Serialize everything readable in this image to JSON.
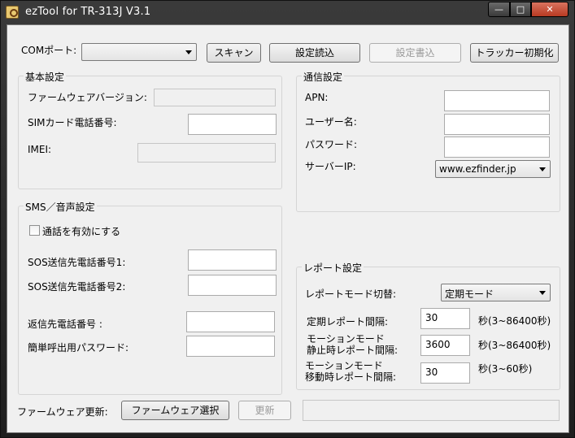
{
  "window": {
    "title": "ezTool for TR-313J V3.1",
    "buttons": {
      "minimize": "—",
      "maximize": "□",
      "close": "✕"
    }
  },
  "top": {
    "com_label": "COMポート:",
    "com_value": "",
    "scan": "スキャン",
    "read": "設定読込",
    "write": "設定書込",
    "reset": "トラッカー初期化"
  },
  "basic": {
    "title": "基本設定",
    "firmware_label": "ファームウェアバージョン:",
    "firmware_value": "",
    "sim_label": "SIMカード電話番号:",
    "sim_value": "",
    "imei_label": "IMEI:",
    "imei_value": ""
  },
  "comm": {
    "title": "通信設定",
    "apn_label": "APN:",
    "apn_value": "",
    "user_label": "ユーザー名:",
    "user_value": "",
    "pass_label": "パスワード:",
    "pass_value": "",
    "server_label": "サーバーIP:",
    "server_value": "www.ezfinder.jp"
  },
  "sms": {
    "title": "SMS／音声設定",
    "enable_call": "通話を有効にする",
    "enable_call_checked": false,
    "sos1_label": "SOS送信先電話番号1:",
    "sos1_value": "",
    "sos2_label": "SOS送信先電話番号2:",
    "sos2_value": "",
    "reply_label": "返信先電話番号 :",
    "reply_value": "",
    "simple_pass_label": "簡単呼出用パスワード:",
    "simple_pass_value": ""
  },
  "report": {
    "title": "レポート設定",
    "mode_label": "レポートモード切替:",
    "mode_value": "定期モード",
    "periodic_label": "定期レポート間隔:",
    "periodic_value": "30",
    "periodic_unit": "秒(3~86400秒)",
    "motion_stop_label1": "モーションモード",
    "motion_stop_label2": "静止時レポート間隔:",
    "motion_stop_value": "3600",
    "motion_stop_unit": "秒(3~86400秒)",
    "motion_move_label1": "モーションモード",
    "motion_move_label2": "移動時レポート間隔:",
    "motion_move_value": "30",
    "motion_move_unit": "秒(3~60秒)"
  },
  "footer": {
    "firmware_update_label": "ファームウェア更新:",
    "select_firmware": "ファームウェア選択",
    "update": "更新",
    "progress_value": ""
  }
}
